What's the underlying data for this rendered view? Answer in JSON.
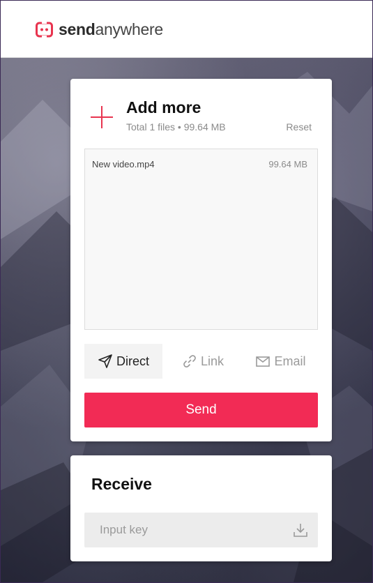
{
  "header": {
    "logo_bold": "send",
    "logo_light": "anywhere",
    "logo_icon": "sendanywhere-logo-icon"
  },
  "send": {
    "add_more_label": "Add more",
    "summary": "Total 1 files • 99.64 MB",
    "reset_label": "Reset",
    "files": [
      {
        "name": "New video.mp4",
        "size": "99.64 MB"
      }
    ],
    "modes": [
      {
        "label": "Direct",
        "icon": "paper-plane-icon",
        "selected": true
      },
      {
        "label": "Link",
        "icon": "link-icon",
        "selected": false
      },
      {
        "label": "Email",
        "icon": "envelope-icon",
        "selected": false
      }
    ],
    "send_button": "Send"
  },
  "receive": {
    "title": "Receive",
    "input_placeholder": "Input key",
    "input_value": ""
  },
  "colors": {
    "accent": "#f22b55",
    "muted_text": "#8a8a8a"
  }
}
